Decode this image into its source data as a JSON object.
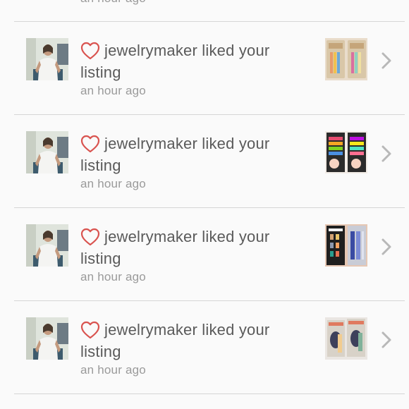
{
  "top_partial": {
    "time": "an hour ago"
  },
  "notifications": [
    {
      "username": "jewelrymaker",
      "action": "liked your listing",
      "time": "an hour ago"
    },
    {
      "username": "jewelrymaker",
      "action": "liked your listing",
      "time": "an hour ago"
    },
    {
      "username": "jewelrymaker",
      "action": "liked your listing",
      "time": "an hour ago"
    },
    {
      "username": "jewelrymaker",
      "action": "liked your listing",
      "time": "an hour ago"
    }
  ],
  "icons": {
    "like": "heart-outline-icon",
    "open": "chevron-right-icon"
  },
  "colors": {
    "heart": "#d9534f",
    "primary_text": "#5a5a5a",
    "secondary_text": "#9a9a9a",
    "divider": "#d6d6d6",
    "chevron": "#b8b8b8",
    "background": "#fafafa"
  }
}
